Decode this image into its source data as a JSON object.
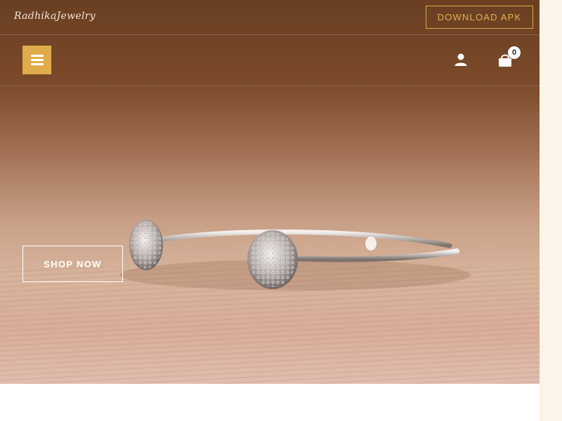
{
  "brand": {
    "logo_text": "RadhikaJewelry"
  },
  "header": {
    "download_label": "DOWNLOAD APK",
    "menu_icon": "hamburger-icon",
    "user_icon": "user-icon",
    "cart_icon": "shopping-bag-icon",
    "cart_count": "0"
  },
  "hero": {
    "cta_label": "SHOP NOW",
    "image_subject": "silver cuff bracelet with crystal pavé ends on wooden surface"
  },
  "colors": {
    "accent": "#e0ac4b",
    "header_brown": "#6a3f22",
    "page_bg": "#ffffff",
    "side_bg": "#fbf4e8"
  }
}
